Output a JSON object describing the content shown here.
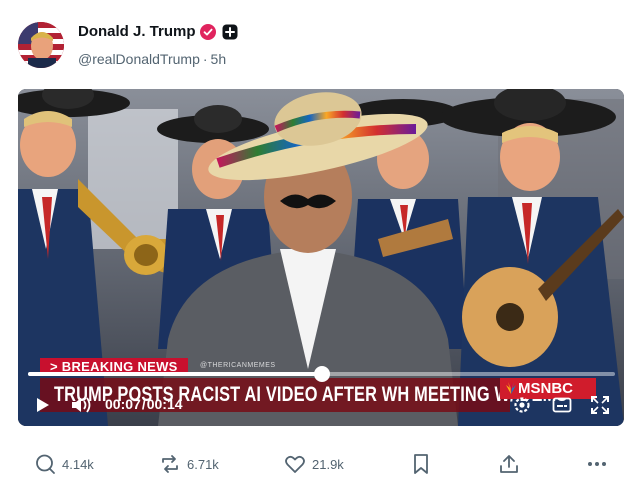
{
  "author": {
    "name": "Donald J. Trump",
    "handle": "@realDonaldTrump",
    "separator": "·",
    "time": "5h",
    "badges": [
      "verified-icon",
      "plus-icon"
    ]
  },
  "video": {
    "lower_third": "> BREAKING NEWS",
    "watermark": "@THERICANMEMES",
    "chyron": "TRUMP POSTS RACIST AI VIDEO AFTER WH MEETING W/ DEMS",
    "network": "MSNBC",
    "current_time": "00:07",
    "time_separator": "/",
    "duration": "00:14",
    "progress_fraction": 0.5,
    "controls": [
      "play-icon",
      "volume-icon",
      "settings-icon",
      "captions-icon",
      "fullscreen-icon"
    ]
  },
  "actions": {
    "replies": "4.14k",
    "reposts": "6.71k",
    "likes": "21.9k",
    "bookmark": "",
    "share": "",
    "more": ""
  },
  "colors": {
    "text_primary": "#0f1419",
    "text_secondary": "#536471",
    "verified_badge": "#e0245e",
    "breaking_red": "#c8102e"
  }
}
